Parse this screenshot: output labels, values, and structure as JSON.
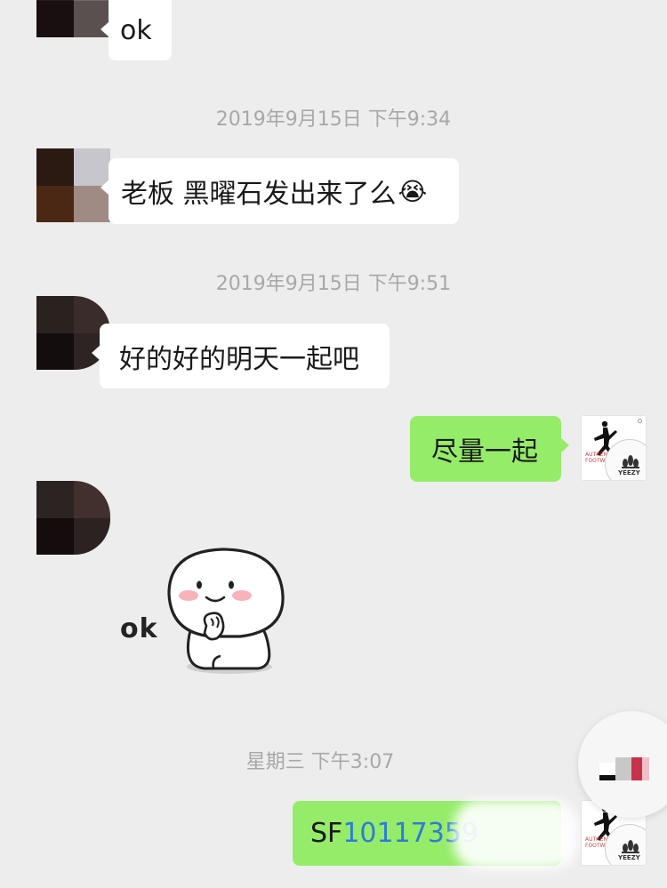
{
  "messages": {
    "m1": {
      "text": "ok"
    },
    "m2": {
      "text": "老板 黑曜石发出来了么",
      "emoji": "😭"
    },
    "m3": {
      "text": "好的好的明天一起吧"
    },
    "m4": {
      "text": "尽量一起"
    },
    "m5": {
      "sticker_text": "ok"
    },
    "m6": {
      "prefix": "SF",
      "tracking_visible": "10117359"
    }
  },
  "timestamps": {
    "t1": "2019年9月15日 下午9:34",
    "t2": "2019年9月15日 下午9:51",
    "t3": "星期三 下午3:07"
  },
  "own_avatar": {
    "badge_text": "YEEZY",
    "tag_text": "AUTHENTIC FOOTWEAR"
  },
  "colors": {
    "background": "#ededed",
    "bubble_incoming": "#ffffff",
    "bubble_outgoing": "#95ec69",
    "timestamp": "#a8a8a8",
    "link": "#2f7bd6"
  },
  "icons": {
    "own_avatar": "jumpman-logo-icon",
    "sticker": "ok-sticker-icon",
    "emoji": "crying-face-icon"
  }
}
